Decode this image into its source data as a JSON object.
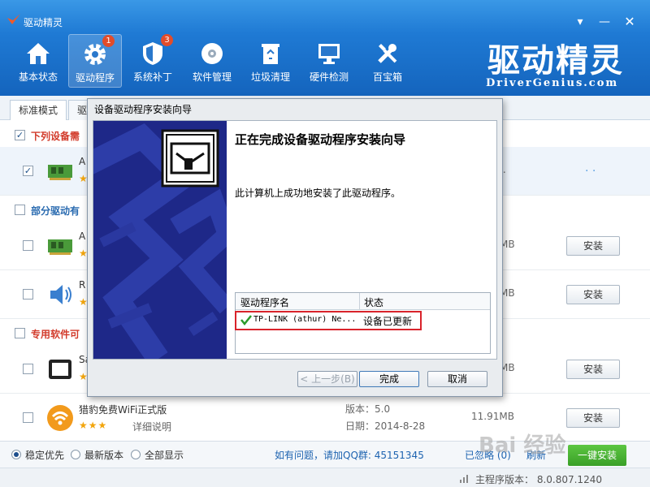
{
  "app": {
    "title": "驱动精灵",
    "brand_large": "驱动精灵",
    "brand_sub": "DriverGenius.com"
  },
  "nav": [
    {
      "label": "基本状态",
      "icon": "house-icon"
    },
    {
      "label": "驱动程序",
      "icon": "gear-icon",
      "badge": "1",
      "active": true
    },
    {
      "label": "系统补丁",
      "icon": "shield-icon",
      "badge": "3"
    },
    {
      "label": "软件管理",
      "icon": "disc-icon"
    },
    {
      "label": "垃圾清理",
      "icon": "recycle-bin-icon"
    },
    {
      "label": "硬件检测",
      "icon": "monitor-icon"
    },
    {
      "label": "百宝箱",
      "icon": "tools-icon"
    }
  ],
  "tabs": {
    "standard": "标准模式",
    "driver": "驱"
  },
  "sections": {
    "s1": "下列设备需",
    "s2": "部分驱动有",
    "s3": "专用软件可"
  },
  "rows": [
    {
      "name": "A",
      "stars": "★",
      "size": "..",
      "checked": true
    },
    {
      "name": "A",
      "stars": "★",
      "size": "MB",
      "install": "安装"
    },
    {
      "name": "R",
      "stars": "★",
      "size": "MB",
      "install": "安装"
    },
    {
      "name": "Sa",
      "stars": "★",
      "size": "MB",
      "install": "安装"
    },
    {
      "name": "猎豹免费WiFi正式版",
      "stars": "★★★",
      "detail": "详细说明",
      "version": "版本：5.0",
      "date": "日期：2014-8-28",
      "size": "11.91MB",
      "install": "安装"
    }
  ],
  "bottom": {
    "opt1": "稳定优先",
    "opt2": "最新版本",
    "opt3": "全部显示",
    "qq": "如有问题，请加QQ群: 45151345",
    "ignored": "已忽略 (0)",
    "refresh": "刷新",
    "install_all": "一键安装"
  },
  "status": {
    "version": "主程序版本： 8.0.807.1240"
  },
  "dialog": {
    "title": "设备驱动程序安装向导",
    "heading": "正在完成设备驱动程序安装向导",
    "message": "此计算机上成功地安装了此驱动程序。",
    "col_name": "驱动程序名",
    "col_status": "状态",
    "driver_name": "TP-LINK (athur) Ne...",
    "driver_status": "设备已更新",
    "back": "< 上一步(B)",
    "finish": "完成",
    "cancel": "取消"
  },
  "watermark": "Bai 经验",
  "colors": {
    "accent_blue": "#1f7ad4",
    "section_red": "#d23a2a",
    "banner_navy": "#1e2888",
    "install_green": "#3aa028",
    "highlight_red": "#d9232b"
  }
}
